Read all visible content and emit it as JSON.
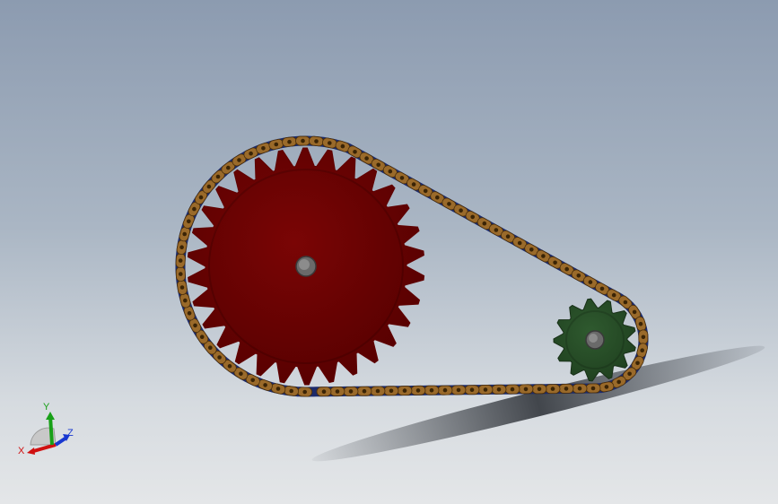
{
  "view": {
    "background_top": "#8c9bb0",
    "background_bottom": "#e4e6e8"
  },
  "model": {
    "large_sprocket": {
      "color": "#8a0a0a",
      "dark_color": "#5e0000",
      "teeth": 30
    },
    "small_sprocket": {
      "color": "#2f5a2f",
      "teeth": 13
    },
    "chain": {
      "roller_color": "#9a6a2a",
      "link_color": "#1c2a6a"
    },
    "shaft_color": "#7a7a7a"
  },
  "triad": {
    "x_label": "X",
    "y_label": "Y",
    "z_label": "Z",
    "x_color": "#d01010",
    "y_color": "#18a018",
    "z_color": "#1838d0"
  }
}
